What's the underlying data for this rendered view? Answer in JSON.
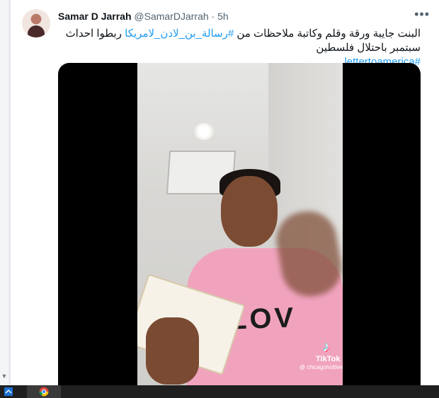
{
  "tweet": {
    "name": "Samar D Jarrah",
    "handle": "@SamarDJarrah",
    "separator": "·",
    "time": "5h",
    "more_label": "•••",
    "line1_part1": "البنت جايبة ورقة وقلم وكاتبة ملاحظات من ",
    "hashtag1": "#رسالة_بن_لادن_لامريكا",
    "line1_part2": " ربطوا احداث",
    "line2": "سبتمبر  باحتلال فلسطين",
    "hashtag2": "#lettertoamerica"
  },
  "media": {
    "tiktok_logo": "♪",
    "tiktok_label": "TikTok",
    "tiktok_user": "@ chicagohottiee",
    "sweater_text": "LOV"
  },
  "taskbar": {
    "start_icon": "start-icon",
    "browser_icon": "chrome-icon"
  },
  "scroll": {
    "arrow": "▼"
  }
}
